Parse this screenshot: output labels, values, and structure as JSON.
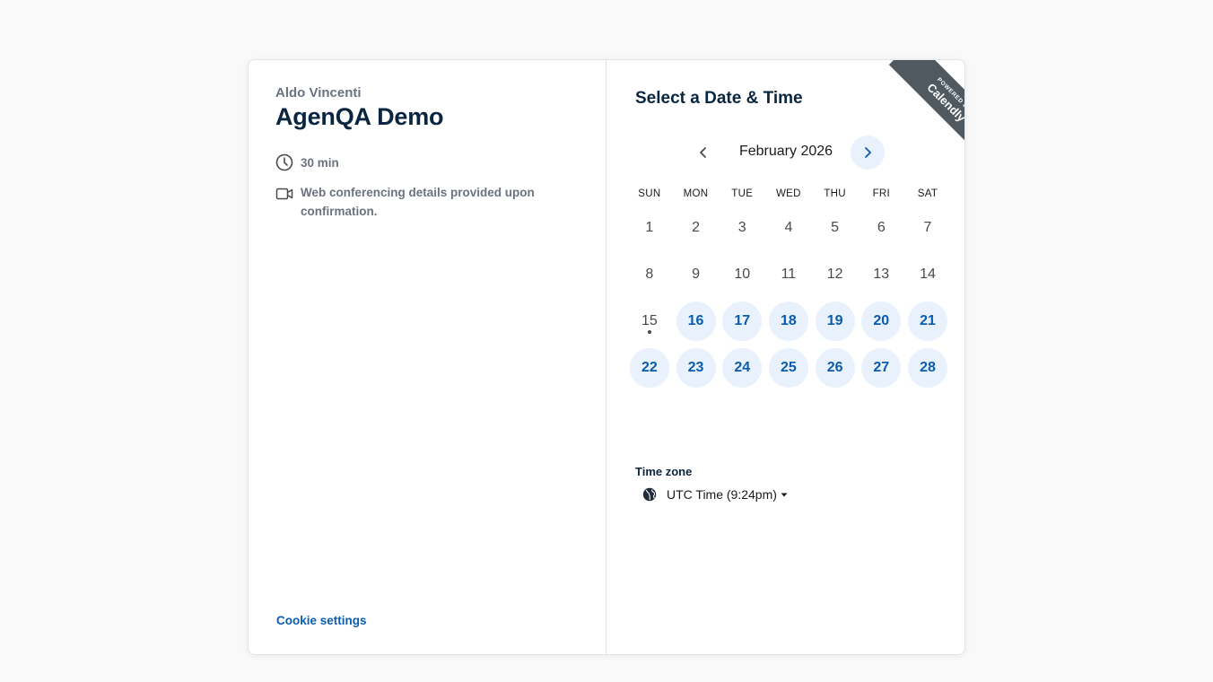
{
  "event": {
    "host_name": "Aldo Vincenti",
    "title": "AgenQA Demo",
    "duration": "30 min",
    "conferencing": "Web conferencing details provided upon confirmation."
  },
  "footer": {
    "cookie_settings": "Cookie settings"
  },
  "calendar": {
    "heading": "Select a Date & Time",
    "month_label": "February 2026",
    "weekdays": [
      "SUN",
      "MON",
      "TUE",
      "WED",
      "THU",
      "FRI",
      "SAT"
    ],
    "days": [
      {
        "n": "1",
        "available": false
      },
      {
        "n": "2",
        "available": false
      },
      {
        "n": "3",
        "available": false
      },
      {
        "n": "4",
        "available": false
      },
      {
        "n": "5",
        "available": false
      },
      {
        "n": "6",
        "available": false
      },
      {
        "n": "7",
        "available": false
      },
      {
        "n": "8",
        "available": false
      },
      {
        "n": "9",
        "available": false
      },
      {
        "n": "10",
        "available": false
      },
      {
        "n": "11",
        "available": false
      },
      {
        "n": "12",
        "available": false
      },
      {
        "n": "13",
        "available": false
      },
      {
        "n": "14",
        "available": false
      },
      {
        "n": "15",
        "available": false,
        "today": true
      },
      {
        "n": "16",
        "available": true
      },
      {
        "n": "17",
        "available": true
      },
      {
        "n": "18",
        "available": true
      },
      {
        "n": "19",
        "available": true
      },
      {
        "n": "20",
        "available": true
      },
      {
        "n": "21",
        "available": true
      },
      {
        "n": "22",
        "available": true
      },
      {
        "n": "23",
        "available": true
      },
      {
        "n": "24",
        "available": true
      },
      {
        "n": "25",
        "available": true
      },
      {
        "n": "26",
        "available": true
      },
      {
        "n": "27",
        "available": true
      },
      {
        "n": "28",
        "available": true
      }
    ]
  },
  "timezone": {
    "label": "Time zone",
    "value": "UTC Time (9:24pm)"
  },
  "badge": {
    "powered_by": "POWERED BY",
    "brand": "Calendly"
  },
  "icons": {
    "duration": "clock-icon",
    "conferencing": "video-camera-icon",
    "prev": "chevron-left-icon",
    "next": "chevron-right-icon",
    "timezone": "globe-icon",
    "dropdown": "caret-down-icon"
  },
  "colors": {
    "accent": "#0b5cad",
    "available_bg": "#e8f1fc",
    "title": "#0a2540",
    "ribbon": "#505960"
  }
}
